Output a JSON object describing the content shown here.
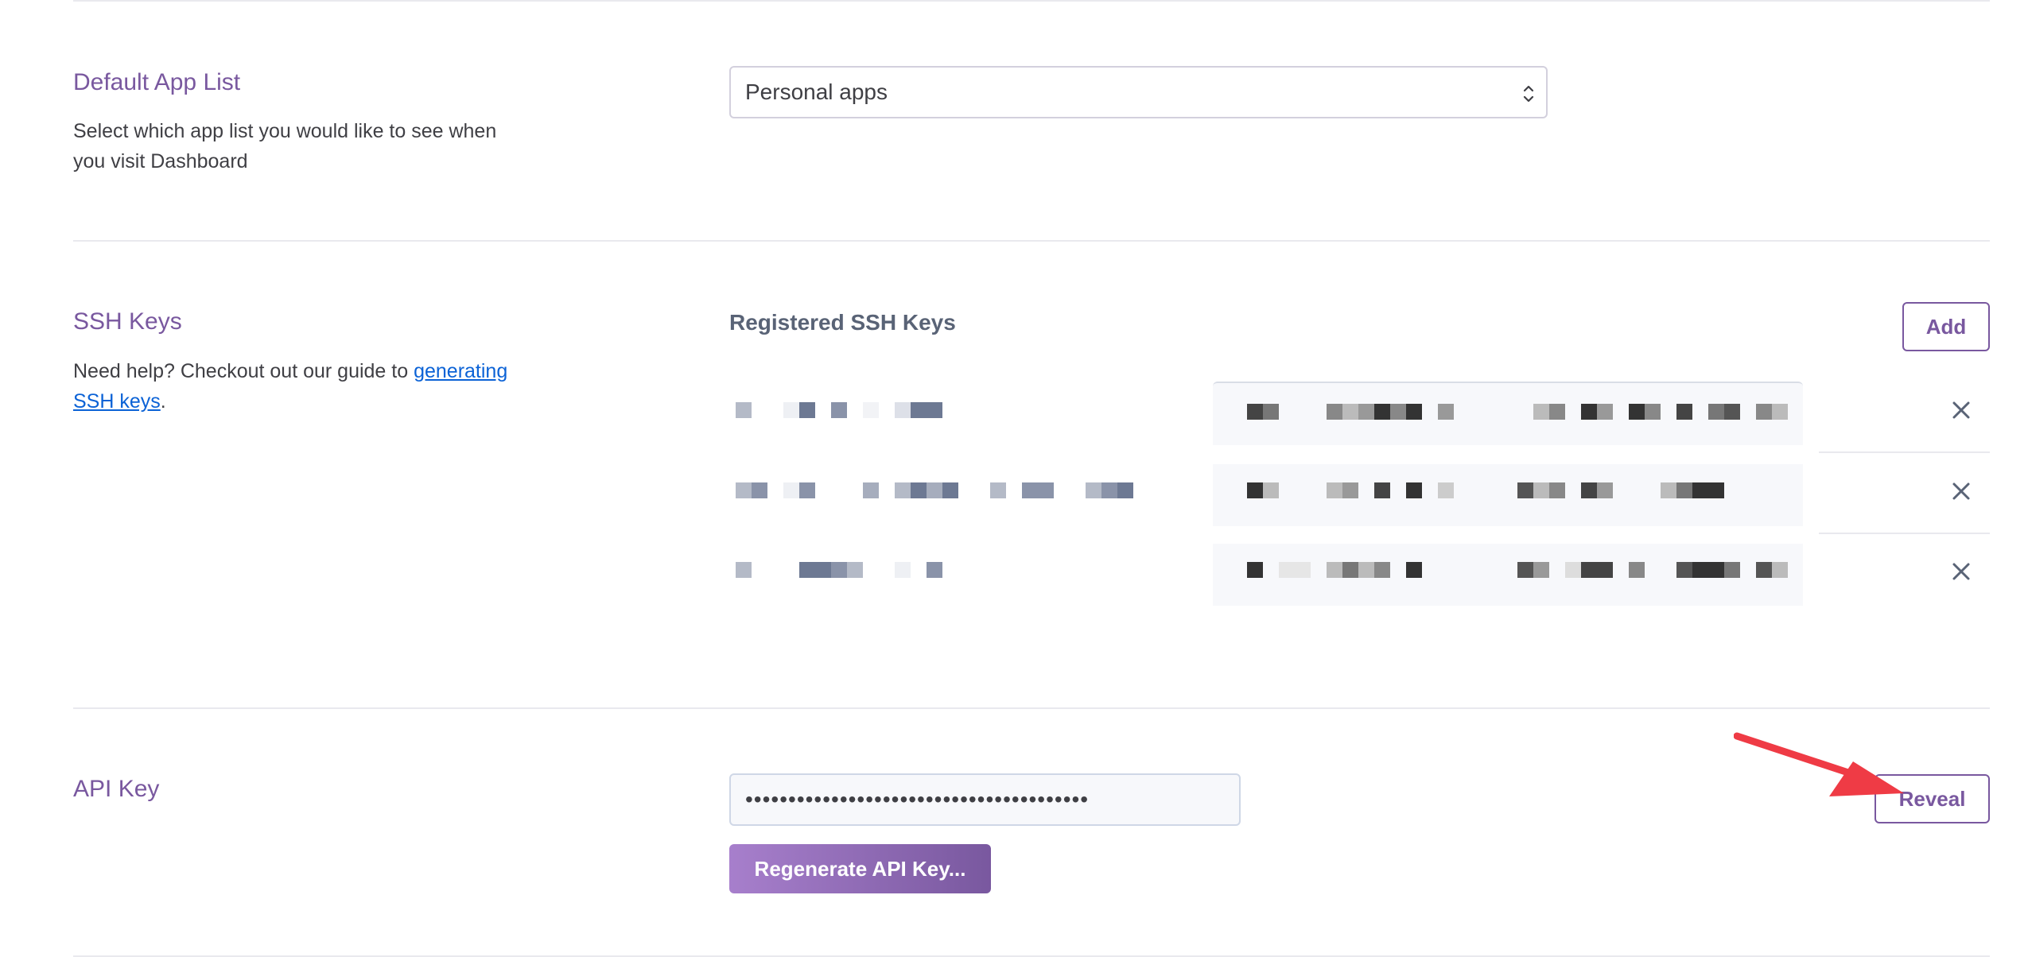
{
  "default_app_list": {
    "title": "Default App List",
    "description": "Select which app list you would like to see when you visit Dashboard",
    "selected_value": "Personal apps"
  },
  "ssh_keys": {
    "title": "SSH Keys",
    "description_prefix": "Need help? Checkout out our guide to ",
    "link_text": "generating SSH keys",
    "description_suffix": ".",
    "list_title": "Registered SSH Keys",
    "add_label": "Add"
  },
  "api_key": {
    "title": "API Key",
    "masked_value": "••••••••••••••••••••••••••••••••••••••••",
    "regenerate_label": "Regenerate API Key...",
    "reveal_label": "Reveal"
  },
  "colors": {
    "accent": "#79589f",
    "link": "#0b62d6",
    "annotation_arrow": "#ef3b45"
  }
}
